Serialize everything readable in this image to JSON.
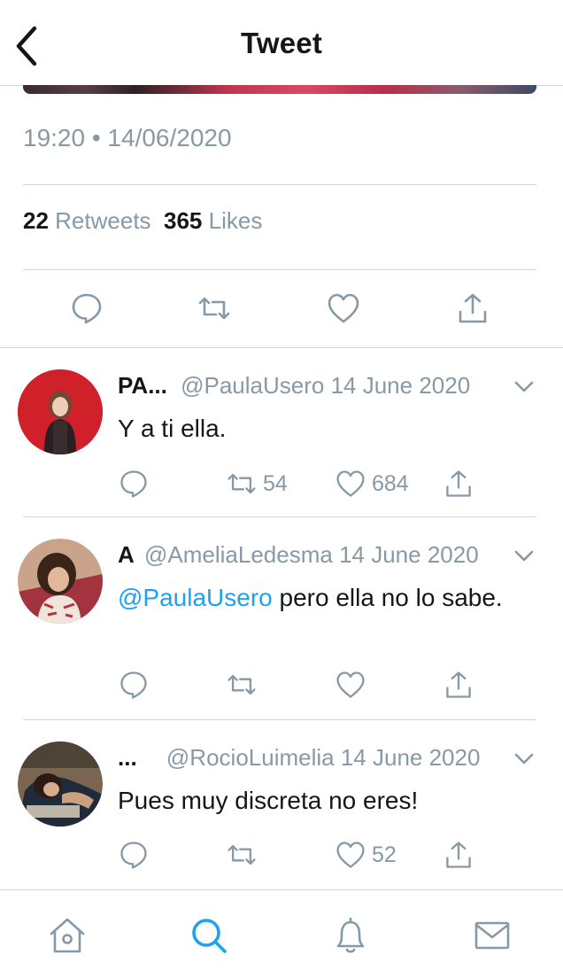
{
  "header": {
    "title": "Tweet",
    "back_icon": "chevron-left-icon"
  },
  "tweet": {
    "timestamp": "19:20 • 14/06/2020",
    "retweets_count": "22",
    "retweets_label": "Retweets",
    "likes_count": "365",
    "likes_label": "Likes",
    "actions": [
      "reply-icon",
      "retweet-icon",
      "like-icon",
      "share-icon"
    ]
  },
  "replies": [
    {
      "name": "PA...",
      "handle": "@PaulaUsero",
      "date": "14 June 2020",
      "mention": "",
      "text": "Y a ti ella.",
      "retweets": "54",
      "likes": "684"
    },
    {
      "name": "A",
      "handle": "@AmeliaLedesma",
      "date": "14 June 2020",
      "mention": "@PaulaUsero",
      "text": "pero ella no lo sabe.",
      "retweets": "",
      "likes": ""
    },
    {
      "name": "...",
      "handle": "@RocioLuimelia",
      "date": "14 June 2020",
      "mention": "",
      "text": "Pues muy discreta no eres!",
      "retweets": "",
      "likes": "52"
    }
  ],
  "bottom_nav": [
    "home-icon",
    "search-icon",
    "notifications-icon",
    "messages-icon"
  ],
  "colors": {
    "accent": "#1da1f2",
    "muted": "#8899a6",
    "divider": "#ccd6dd",
    "text": "#14171a"
  }
}
